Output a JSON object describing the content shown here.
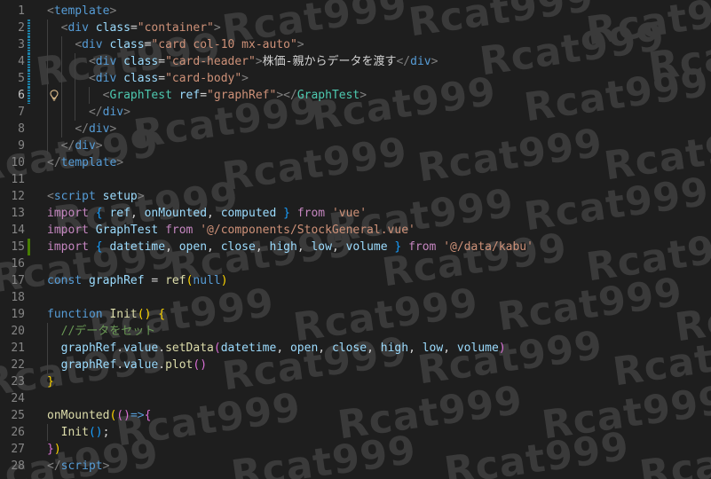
{
  "editor": {
    "watermark_text": "Rcat999",
    "lines": [
      {
        "n": "1",
        "mod": "",
        "guides": 0,
        "tokens": [
          {
            "c": "t-bracket",
            "t": "<"
          },
          {
            "c": "t-tag",
            "t": "template"
          },
          {
            "c": "t-bracket",
            "t": ">"
          }
        ]
      },
      {
        "n": "2",
        "mod": "modified",
        "guides": 1,
        "tokens": [
          {
            "c": "t-text",
            "t": "  "
          },
          {
            "c": "t-bracket",
            "t": "<"
          },
          {
            "c": "t-tag",
            "t": "div"
          },
          {
            "c": "t-text",
            "t": " "
          },
          {
            "c": "t-attr",
            "t": "class"
          },
          {
            "c": "t-text",
            "t": "="
          },
          {
            "c": "t-str",
            "t": "\"container\""
          },
          {
            "c": "t-bracket",
            "t": ">"
          }
        ]
      },
      {
        "n": "3",
        "mod": "modified",
        "guides": 2,
        "tokens": [
          {
            "c": "t-text",
            "t": "    "
          },
          {
            "c": "t-bracket",
            "t": "<"
          },
          {
            "c": "t-tag",
            "t": "div"
          },
          {
            "c": "t-text",
            "t": " "
          },
          {
            "c": "t-attr",
            "t": "class"
          },
          {
            "c": "t-text",
            "t": "="
          },
          {
            "c": "t-str",
            "t": "\"card col-10 mx-auto\""
          },
          {
            "c": "t-bracket",
            "t": ">"
          }
        ]
      },
      {
        "n": "4",
        "mod": "modified",
        "guides": 3,
        "tokens": [
          {
            "c": "t-text",
            "t": "      "
          },
          {
            "c": "t-bracket",
            "t": "<"
          },
          {
            "c": "t-tag",
            "t": "div"
          },
          {
            "c": "t-text",
            "t": " "
          },
          {
            "c": "t-attr",
            "t": "class"
          },
          {
            "c": "t-text",
            "t": "="
          },
          {
            "c": "t-str",
            "t": "\"card-header\""
          },
          {
            "c": "t-bracket",
            "t": ">"
          },
          {
            "c": "t-text",
            "t": "株価-親からデータを渡す"
          },
          {
            "c": "t-bracket",
            "t": "</"
          },
          {
            "c": "t-tag",
            "t": "div"
          },
          {
            "c": "t-bracket",
            "t": ">"
          }
        ]
      },
      {
        "n": "5",
        "mod": "modified",
        "guides": 3,
        "tokens": [
          {
            "c": "t-text",
            "t": "      "
          },
          {
            "c": "t-bracket",
            "t": "<"
          },
          {
            "c": "t-tag",
            "t": "div"
          },
          {
            "c": "t-text",
            "t": " "
          },
          {
            "c": "t-attr",
            "t": "class"
          },
          {
            "c": "t-text",
            "t": "="
          },
          {
            "c": "t-str",
            "t": "\"card-body\""
          },
          {
            "c": "t-bracket",
            "t": ">"
          }
        ]
      },
      {
        "n": "6",
        "mod": "modified",
        "guides": 4,
        "active": true,
        "bulb": true,
        "tokens": [
          {
            "c": "t-text",
            "t": "        "
          },
          {
            "c": "t-bracket",
            "t": "<"
          },
          {
            "c": "t-comp",
            "t": "GraphTest"
          },
          {
            "c": "t-text",
            "t": " "
          },
          {
            "c": "t-attr",
            "t": "ref"
          },
          {
            "c": "t-text",
            "t": "="
          },
          {
            "c": "t-str",
            "t": "\"graphRef\""
          },
          {
            "c": "t-bracket",
            "t": "></"
          },
          {
            "c": "t-comp",
            "t": "GraphTest"
          },
          {
            "c": "t-bracket",
            "t": ">"
          }
        ]
      },
      {
        "n": "7",
        "mod": "",
        "guides": 3,
        "tokens": [
          {
            "c": "t-text",
            "t": "      "
          },
          {
            "c": "t-bracket",
            "t": "</"
          },
          {
            "c": "t-tag",
            "t": "div"
          },
          {
            "c": "t-bracket",
            "t": ">"
          }
        ]
      },
      {
        "n": "8",
        "mod": "",
        "guides": 2,
        "tokens": [
          {
            "c": "t-text",
            "t": "    "
          },
          {
            "c": "t-bracket",
            "t": "</"
          },
          {
            "c": "t-tag",
            "t": "div"
          },
          {
            "c": "t-bracket",
            "t": ">"
          }
        ]
      },
      {
        "n": "9",
        "mod": "",
        "guides": 1,
        "tokens": [
          {
            "c": "t-text",
            "t": "  "
          },
          {
            "c": "t-bracket",
            "t": "</"
          },
          {
            "c": "t-tag",
            "t": "div"
          },
          {
            "c": "t-bracket",
            "t": ">"
          }
        ]
      },
      {
        "n": "10",
        "mod": "",
        "guides": 0,
        "tokens": [
          {
            "c": "t-bracket",
            "t": "</"
          },
          {
            "c": "t-tag",
            "t": "template"
          },
          {
            "c": "t-bracket",
            "t": ">"
          }
        ]
      },
      {
        "n": "11",
        "mod": "",
        "guides": 0,
        "tokens": []
      },
      {
        "n": "12",
        "mod": "",
        "guides": 0,
        "tokens": [
          {
            "c": "t-bracket",
            "t": "<"
          },
          {
            "c": "t-tag",
            "t": "script"
          },
          {
            "c": "t-text",
            "t": " "
          },
          {
            "c": "t-attr",
            "t": "setup"
          },
          {
            "c": "t-bracket",
            "t": ">"
          }
        ]
      },
      {
        "n": "13",
        "mod": "",
        "guides": 0,
        "tokens": [
          {
            "c": "t-kw",
            "t": "import"
          },
          {
            "c": "t-text",
            "t": " "
          },
          {
            "c": "t-blue",
            "t": "{"
          },
          {
            "c": "t-text",
            "t": " "
          },
          {
            "c": "t-var",
            "t": "ref"
          },
          {
            "c": "t-punc",
            "t": ", "
          },
          {
            "c": "t-var",
            "t": "onMounted"
          },
          {
            "c": "t-punc",
            "t": ", "
          },
          {
            "c": "t-var",
            "t": "computed"
          },
          {
            "c": "t-text",
            "t": " "
          },
          {
            "c": "t-blue",
            "t": "}"
          },
          {
            "c": "t-text",
            "t": " "
          },
          {
            "c": "t-kw",
            "t": "from"
          },
          {
            "c": "t-text",
            "t": " "
          },
          {
            "c": "t-str",
            "t": "'vue'"
          }
        ]
      },
      {
        "n": "14",
        "mod": "",
        "guides": 0,
        "tokens": [
          {
            "c": "t-kw",
            "t": "import"
          },
          {
            "c": "t-text",
            "t": " "
          },
          {
            "c": "t-var",
            "t": "GraphTest"
          },
          {
            "c": "t-text",
            "t": " "
          },
          {
            "c": "t-kw",
            "t": "from"
          },
          {
            "c": "t-text",
            "t": " "
          },
          {
            "c": "t-str",
            "t": "'@/components/StockGeneral.vue'"
          }
        ]
      },
      {
        "n": "15",
        "mod": "added",
        "guides": 0,
        "tokens": [
          {
            "c": "t-kw",
            "t": "import"
          },
          {
            "c": "t-text",
            "t": " "
          },
          {
            "c": "t-blue",
            "t": "{"
          },
          {
            "c": "t-text",
            "t": " "
          },
          {
            "c": "t-var",
            "t": "datetime"
          },
          {
            "c": "t-punc",
            "t": ", "
          },
          {
            "c": "t-var",
            "t": "open"
          },
          {
            "c": "t-punc",
            "t": ", "
          },
          {
            "c": "t-var",
            "t": "close"
          },
          {
            "c": "t-punc",
            "t": ", "
          },
          {
            "c": "t-var",
            "t": "high"
          },
          {
            "c": "t-punc",
            "t": ", "
          },
          {
            "c": "t-var",
            "t": "low"
          },
          {
            "c": "t-punc",
            "t": ", "
          },
          {
            "c": "t-var",
            "t": "volume"
          },
          {
            "c": "t-text",
            "t": " "
          },
          {
            "c": "t-blue",
            "t": "}"
          },
          {
            "c": "t-text",
            "t": " "
          },
          {
            "c": "t-kw",
            "t": "from"
          },
          {
            "c": "t-text",
            "t": " "
          },
          {
            "c": "t-str",
            "t": "'@/data/kabu'"
          }
        ]
      },
      {
        "n": "16",
        "mod": "",
        "guides": 0,
        "tokens": []
      },
      {
        "n": "17",
        "mod": "",
        "guides": 0,
        "tokens": [
          {
            "c": "t-decl",
            "t": "const"
          },
          {
            "c": "t-text",
            "t": " "
          },
          {
            "c": "t-var",
            "t": "graphRef"
          },
          {
            "c": "t-text",
            "t": " = "
          },
          {
            "c": "t-fn",
            "t": "ref"
          },
          {
            "c": "t-brace",
            "t": "("
          },
          {
            "c": "t-decl",
            "t": "null"
          },
          {
            "c": "t-brace",
            "t": ")"
          }
        ]
      },
      {
        "n": "18",
        "mod": "",
        "guides": 0,
        "tokens": []
      },
      {
        "n": "19",
        "mod": "",
        "guides": 0,
        "tokens": [
          {
            "c": "t-decl",
            "t": "function"
          },
          {
            "c": "t-text",
            "t": " "
          },
          {
            "c": "t-fn",
            "t": "Init"
          },
          {
            "c": "t-brace",
            "t": "()"
          },
          {
            "c": "t-text",
            "t": " "
          },
          {
            "c": "t-brace",
            "t": "{"
          }
        ]
      },
      {
        "n": "20",
        "mod": "",
        "guides": 1,
        "tokens": [
          {
            "c": "t-text",
            "t": "  "
          },
          {
            "c": "t-comment",
            "t": "//データをセット"
          }
        ]
      },
      {
        "n": "21",
        "mod": "",
        "guides": 1,
        "tokens": [
          {
            "c": "t-text",
            "t": "  "
          },
          {
            "c": "t-var",
            "t": "graphRef"
          },
          {
            "c": "t-punc",
            "t": "."
          },
          {
            "c": "t-var",
            "t": "value"
          },
          {
            "c": "t-punc",
            "t": "."
          },
          {
            "c": "t-fn",
            "t": "setData"
          },
          {
            "c": "t-paren",
            "t": "("
          },
          {
            "c": "t-var",
            "t": "datetime"
          },
          {
            "c": "t-punc",
            "t": ", "
          },
          {
            "c": "t-var",
            "t": "open"
          },
          {
            "c": "t-punc",
            "t": ", "
          },
          {
            "c": "t-var",
            "t": "close"
          },
          {
            "c": "t-punc",
            "t": ", "
          },
          {
            "c": "t-var",
            "t": "high"
          },
          {
            "c": "t-punc",
            "t": ", "
          },
          {
            "c": "t-var",
            "t": "low"
          },
          {
            "c": "t-punc",
            "t": ", "
          },
          {
            "c": "t-var",
            "t": "volume"
          },
          {
            "c": "t-paren",
            "t": ")"
          }
        ]
      },
      {
        "n": "22",
        "mod": "",
        "guides": 1,
        "tokens": [
          {
            "c": "t-text",
            "t": "  "
          },
          {
            "c": "t-var",
            "t": "graphRef"
          },
          {
            "c": "t-punc",
            "t": "."
          },
          {
            "c": "t-var",
            "t": "value"
          },
          {
            "c": "t-punc",
            "t": "."
          },
          {
            "c": "t-fn",
            "t": "plot"
          },
          {
            "c": "t-paren",
            "t": "()"
          }
        ]
      },
      {
        "n": "23",
        "mod": "",
        "guides": 0,
        "tokens": [
          {
            "c": "t-brace",
            "t": "}"
          }
        ]
      },
      {
        "n": "24",
        "mod": "",
        "guides": 0,
        "tokens": []
      },
      {
        "n": "25",
        "mod": "",
        "guides": 0,
        "tokens": [
          {
            "c": "t-fn",
            "t": "onMounted"
          },
          {
            "c": "t-brace",
            "t": "("
          },
          {
            "c": "t-paren",
            "t": "()"
          },
          {
            "c": "t-decl",
            "t": "=>"
          },
          {
            "c": "t-paren",
            "t": "{"
          }
        ]
      },
      {
        "n": "26",
        "mod": "",
        "guides": 1,
        "tokens": [
          {
            "c": "t-text",
            "t": "  "
          },
          {
            "c": "t-fn",
            "t": "Init"
          },
          {
            "c": "t-blue",
            "t": "()"
          },
          {
            "c": "t-punc",
            "t": ";"
          }
        ]
      },
      {
        "n": "27",
        "mod": "",
        "guides": 0,
        "tokens": [
          {
            "c": "t-paren",
            "t": "}"
          },
          {
            "c": "t-brace",
            "t": ")"
          }
        ]
      },
      {
        "n": "28",
        "mod": "",
        "guides": 0,
        "tokens": [
          {
            "c": "t-bracket",
            "t": "</"
          },
          {
            "c": "t-tag",
            "t": "script"
          },
          {
            "c": "t-bracket",
            "t": ">"
          }
        ]
      }
    ]
  }
}
